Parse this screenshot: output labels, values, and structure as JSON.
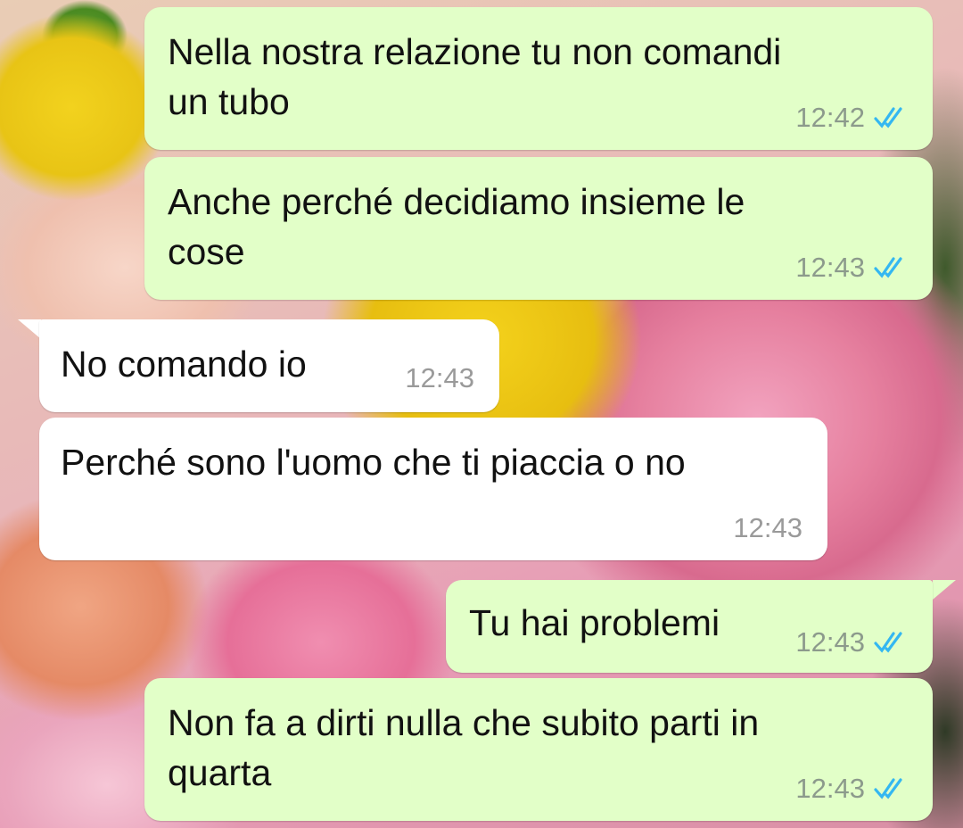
{
  "messages": [
    {
      "text": "Nella nostra relazione tu non comandi\nun tubo",
      "time": "12:42",
      "direction": "outgoing",
      "status": "read"
    },
    {
      "text": "Anche perché decidiamo insieme le\ncose",
      "time": "12:43",
      "direction": "outgoing",
      "status": "read"
    },
    {
      "text": "No comando io",
      "time": "12:43",
      "direction": "incoming"
    },
    {
      "text": "Perché sono l'uomo che ti piaccia o no",
      "time": "12:43",
      "direction": "incoming"
    },
    {
      "text": "Tu hai problemi",
      "time": "12:43",
      "direction": "outgoing",
      "status": "read"
    },
    {
      "text": "Non fa a dirti nulla che subito parti in\nquarta",
      "time": "12:43",
      "direction": "outgoing",
      "status": "read"
    }
  ],
  "colors": {
    "outgoing_bubble": "#e2ffc8",
    "incoming_bubble": "#ffffff",
    "read_ticks": "#34b7f1"
  },
  "icons": {
    "read_receipt": "double-check-icon"
  }
}
